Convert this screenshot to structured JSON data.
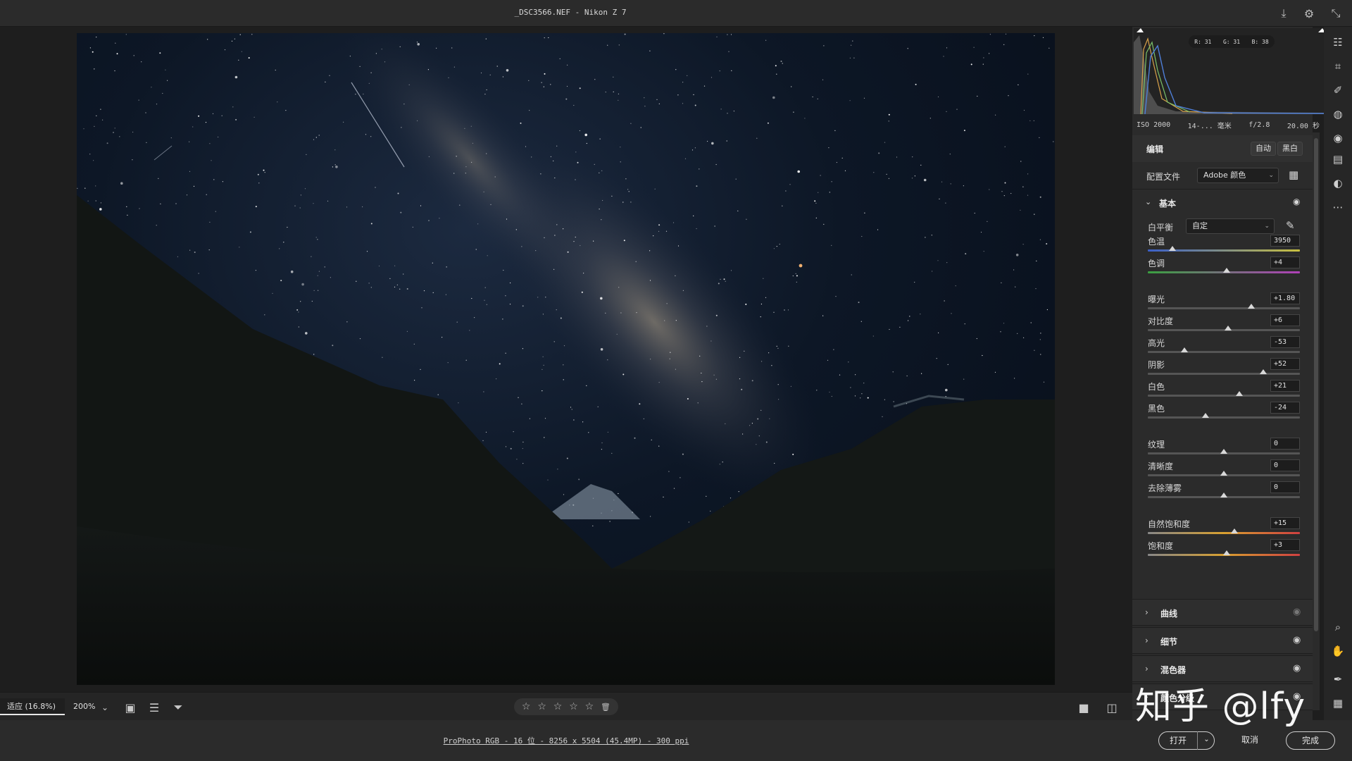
{
  "titlebar": {
    "title": "_DSC3566.NEF -  Nikon Z 7",
    "icons": [
      "download-icon",
      "gear-icon",
      "collapse-icon"
    ]
  },
  "bottombar": {
    "zoom_fit": "适应 (16.8%)",
    "zoom_200": "200%",
    "zoom_dropdown": "⌄",
    "rating": [
      "☆",
      "☆",
      "☆",
      "☆",
      "☆"
    ],
    "trash": "🗑"
  },
  "status": {
    "fileinfo": "ProPhoto RGB - 16 位 - 8256 x 5504 (45.4MP) - 300 ppi",
    "open": "打开",
    "cancel": "取消",
    "done": "完成"
  },
  "histogram": {
    "r": "R: 31",
    "g": "G: 31",
    "b": "B: 38"
  },
  "exif": {
    "iso": "ISO 2000",
    "focal": "14-... 毫米",
    "aperture": "f/2.8",
    "shutter": "20.00 秒"
  },
  "edit": {
    "title": "编辑",
    "auto": "自动",
    "bw": "黑白",
    "profile_label": "配置文件",
    "profile_value": "Adobe 颜色"
  },
  "basic": {
    "title": "基本",
    "wb_label": "白平衡",
    "wb_value": "自定"
  },
  "sliders": {
    "temp": {
      "label": "色温",
      "value": "3950",
      "pos": 0.16
    },
    "tint": {
      "label": "色调",
      "value": "+4",
      "pos": 0.52
    },
    "exposure": {
      "label": "曝光",
      "value": "+1.80",
      "pos": 0.68
    },
    "contrast": {
      "label": "对比度",
      "value": "+6",
      "pos": 0.53
    },
    "highlights": {
      "label": "高光",
      "value": "-53",
      "pos": 0.24
    },
    "shadows": {
      "label": "阴影",
      "value": "+52",
      "pos": 0.76
    },
    "whites": {
      "label": "白色",
      "value": "+21",
      "pos": 0.6
    },
    "blacks": {
      "label": "黑色",
      "value": "-24",
      "pos": 0.38
    },
    "texture": {
      "label": "纹理",
      "value": "0",
      "pos": 0.5
    },
    "clarity": {
      "label": "清晰度",
      "value": "0",
      "pos": 0.5
    },
    "dehaze": {
      "label": "去除薄雾",
      "value": "0",
      "pos": 0.5
    },
    "vibrance": {
      "label": "自然饱和度",
      "value": "+15",
      "pos": 0.57
    },
    "saturation": {
      "label": "饱和度",
      "value": "+3",
      "pos": 0.52
    }
  },
  "sections": {
    "curve": "曲线",
    "detail": "细节",
    "mixer": "混色器",
    "grading": "颜色分级"
  },
  "watermark": "知乎 @lfy"
}
